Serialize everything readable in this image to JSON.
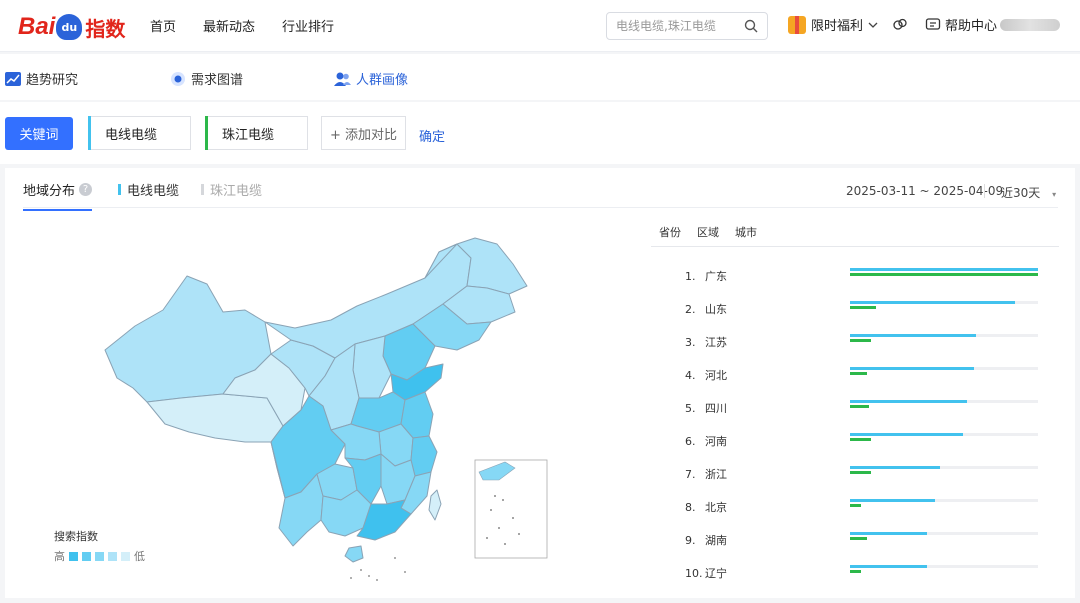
{
  "brand": {
    "bai": "Bai",
    "du": "du",
    "zs": "指数"
  },
  "nav": [
    "首页",
    "最新动态",
    "行业排行"
  ],
  "search": {
    "placeholder": "电线电缆,珠江电缆"
  },
  "topright": {
    "welfare": "限时福利",
    "help": "帮助中心"
  },
  "subtabs": {
    "trend": "趋势研究",
    "demand": "需求图谱",
    "crowd": "人群画像"
  },
  "keywords": {
    "label": "关键词",
    "items": [
      {
        "name": "电线电缆",
        "color": "#42c2ee"
      },
      {
        "name": "珠江电缆",
        "color": "#2cb84a"
      }
    ],
    "add": "+ 添加对比",
    "confirm": "确定"
  },
  "panel": {
    "tab": "地域分布",
    "help_icon": "?",
    "legend": [
      "电线电缆",
      "珠江电缆"
    ],
    "date_range": "2025-03-11 ~ 2025-04-09",
    "period": "近30天",
    "map_legend": {
      "title": "搜索指数",
      "high": "高",
      "low": "低",
      "colors": [
        "#3fc1ee",
        "#62cdf2",
        "#86d8f5",
        "#aee3f8",
        "#d4eff9"
      ]
    },
    "rank_headers": [
      "省份",
      "区域",
      "城市"
    ]
  },
  "ranking": [
    {
      "rank": "1.",
      "name": "广东",
      "a": 1.0,
      "b": 1.0
    },
    {
      "rank": "2.",
      "name": "山东",
      "a": 0.88,
      "b": 0.14
    },
    {
      "rank": "3.",
      "name": "江苏",
      "a": 0.67,
      "b": 0.11
    },
    {
      "rank": "4.",
      "name": "河北",
      "a": 0.66,
      "b": 0.09
    },
    {
      "rank": "5.",
      "name": "四川",
      "a": 0.62,
      "b": 0.1
    },
    {
      "rank": "6.",
      "name": "河南",
      "a": 0.6,
      "b": 0.11
    },
    {
      "rank": "7.",
      "name": "浙江",
      "a": 0.48,
      "b": 0.11
    },
    {
      "rank": "8.",
      "name": "北京",
      "a": 0.45,
      "b": 0.06
    },
    {
      "rank": "9.",
      "name": "湖南",
      "a": 0.41,
      "b": 0.09
    },
    {
      "rank": "10.",
      "name": "辽宁",
      "a": 0.41,
      "b": 0.06
    }
  ]
}
